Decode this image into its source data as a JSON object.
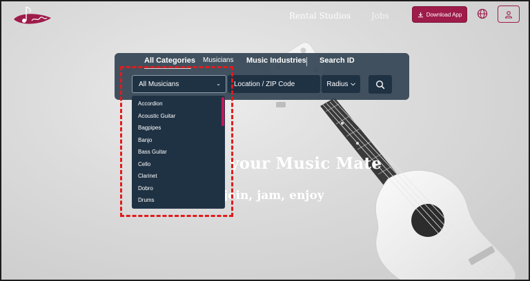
{
  "header": {
    "nav": {
      "rental_studios": "Rental Studios",
      "jobs": "Jobs"
    },
    "download_app": "Download App",
    "icons": {
      "download": "download-icon",
      "globe": "globe-icon",
      "user": "user-icon"
    }
  },
  "search": {
    "tabs": [
      "All Categories",
      "Musicians",
      "Music Industries",
      "Search ID"
    ],
    "active_tab": "All Categories",
    "category_select": "All Musicians",
    "location_placeholder": "Location / ZIP Code",
    "radius": "Radius"
  },
  "dropdown": {
    "options": [
      "Accordion",
      "Acoustic Guitar",
      "Bagpipes",
      "Banjo",
      "Bass Guitar",
      "Cello",
      "Clarinet",
      "Dobro",
      "Drums"
    ]
  },
  "hero": {
    "title": "your Music Mate",
    "subtitle": "join, jam, enjoy"
  },
  "colors": {
    "brand": "#9e1b4a",
    "panel": "#344554",
    "field": "#1f3244",
    "highlight": "#e21b1b"
  }
}
